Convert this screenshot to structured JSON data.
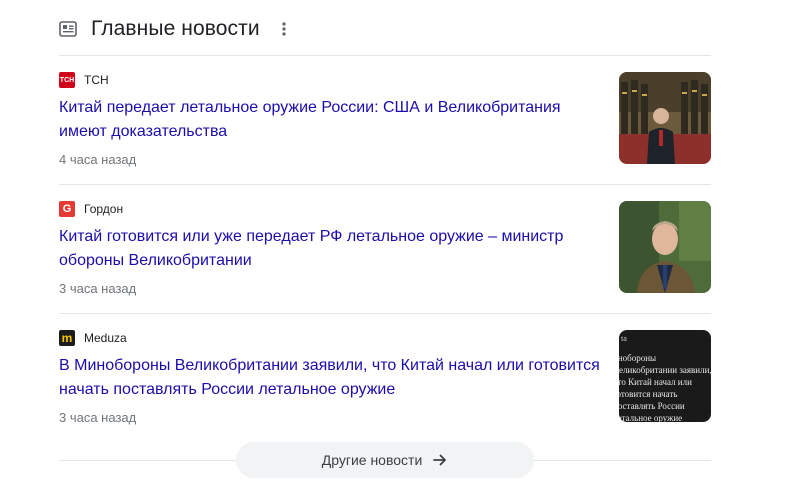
{
  "header": {
    "title": "Главные новости",
    "icon": "newspaper-icon",
    "more_icon": "more-vert-icon"
  },
  "articles": [
    {
      "source": "ТСН",
      "favicon_text": "ТСН",
      "favicon_color": "#d0021b",
      "headline": "Китай передает летальное оружие России: США и Великобритания имеют доказательства",
      "time": "4 часа назад",
      "thumbnail": "xi-jinping-honor-guard-photo"
    },
    {
      "source": "Гордон",
      "favicon_text": "G",
      "favicon_color": "#e53935",
      "headline": "Китай готовится или уже передает РФ летальное оружие – министр обороны Великобритании",
      "time": "3 часа назад",
      "thumbnail": "defence-minister-portrait-photo"
    },
    {
      "source": "Meduza",
      "favicon_text": "m",
      "favicon_color": "#1c1c1c",
      "headline": "В Минобороны Великобритании заявили, что Китай начал или готовится начать поставлять России летальное оружие",
      "time": "3 часа назад",
      "thumbnail": "meduza-text-card",
      "thumbnail_text_top": "ta",
      "thumbnail_text_body": "инобороны Великобритании заявили, что Китай начал или готовится начать поставлять России летальное оружие"
    }
  ],
  "footer": {
    "more_label": "Другие новости",
    "arrow_icon": "arrow-right-icon"
  },
  "colors": {
    "link": "#1a0dab",
    "muted": "#70757a",
    "divider": "#e6e6e6"
  }
}
